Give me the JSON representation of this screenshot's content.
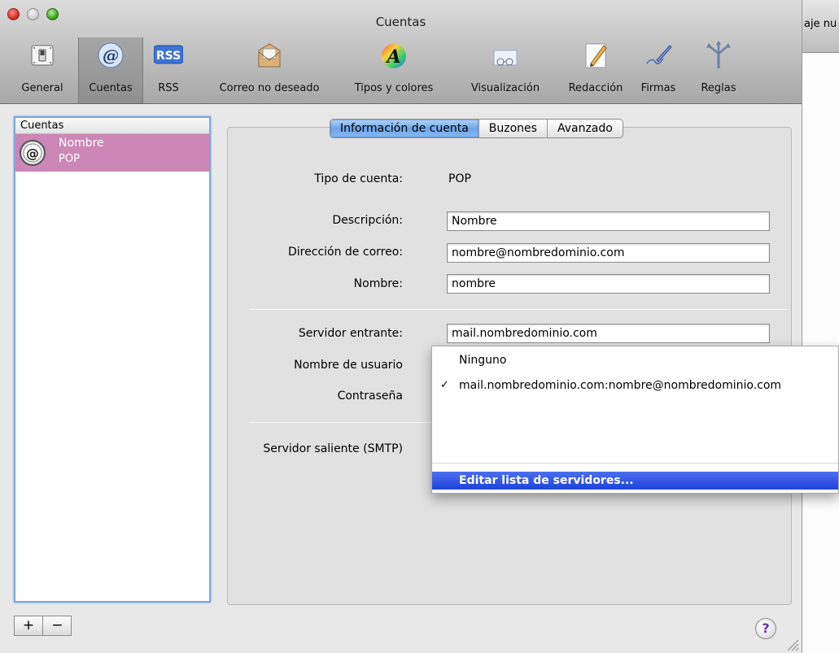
{
  "window": {
    "title": "Cuentas"
  },
  "background_window": {
    "title_fragment": "aje nu"
  },
  "toolbar": {
    "items": [
      {
        "label": "General",
        "icon": "switch-icon"
      },
      {
        "label": "Cuentas",
        "icon": "at-icon",
        "selected": true
      },
      {
        "label": "RSS",
        "icon": "rss-icon"
      },
      {
        "label": "Correo no deseado",
        "icon": "junk-mail-icon"
      },
      {
        "label": "Tipos y colores",
        "icon": "fonts-colors-icon"
      },
      {
        "label": "Visualización",
        "icon": "glasses-icon"
      },
      {
        "label": "Redacción",
        "icon": "compose-pencil-icon"
      },
      {
        "label": "Firmas",
        "icon": "signature-pen-icon"
      },
      {
        "label": "Reglas",
        "icon": "rules-arrows-icon"
      }
    ]
  },
  "accounts": {
    "header": "Cuentas",
    "items": [
      {
        "name": "Nombre",
        "type": "POP",
        "selected": true
      }
    ],
    "add_label": "+",
    "remove_label": "−"
  },
  "tabs": [
    {
      "label": "Información de cuenta",
      "active": true
    },
    {
      "label": "Buzones",
      "active": false
    },
    {
      "label": "Avanzado",
      "active": false
    }
  ],
  "form": {
    "account_type_label": "Tipo de cuenta:",
    "account_type_value": "POP",
    "description_label": "Descripción:",
    "description_value": "Nombre",
    "email_label": "Dirección de correo:",
    "email_value": "nombre@nombredominio.com",
    "name_label": "Nombre:",
    "name_value": "nombre",
    "incoming_label": "Servidor entrante:",
    "incoming_value": "mail.nombredominio.com",
    "username_label": "Nombre de usuario",
    "password_label": "Contraseña",
    "smtp_label": "Servidor saliente (SMTP)"
  },
  "smtp_menu": {
    "items": [
      {
        "label": "Ninguno",
        "checked": false
      },
      {
        "label": "mail.nombredominio.com:nombre@nombredominio.com",
        "checked": true
      }
    ],
    "check_mark": "✓",
    "edit_label": "Editar lista de servidores..."
  },
  "help_label": "?",
  "colors": {
    "selection_pink": "#cc87b6",
    "menu_highlight": "#1e44d8",
    "tab_active": "#6ea6ea"
  }
}
